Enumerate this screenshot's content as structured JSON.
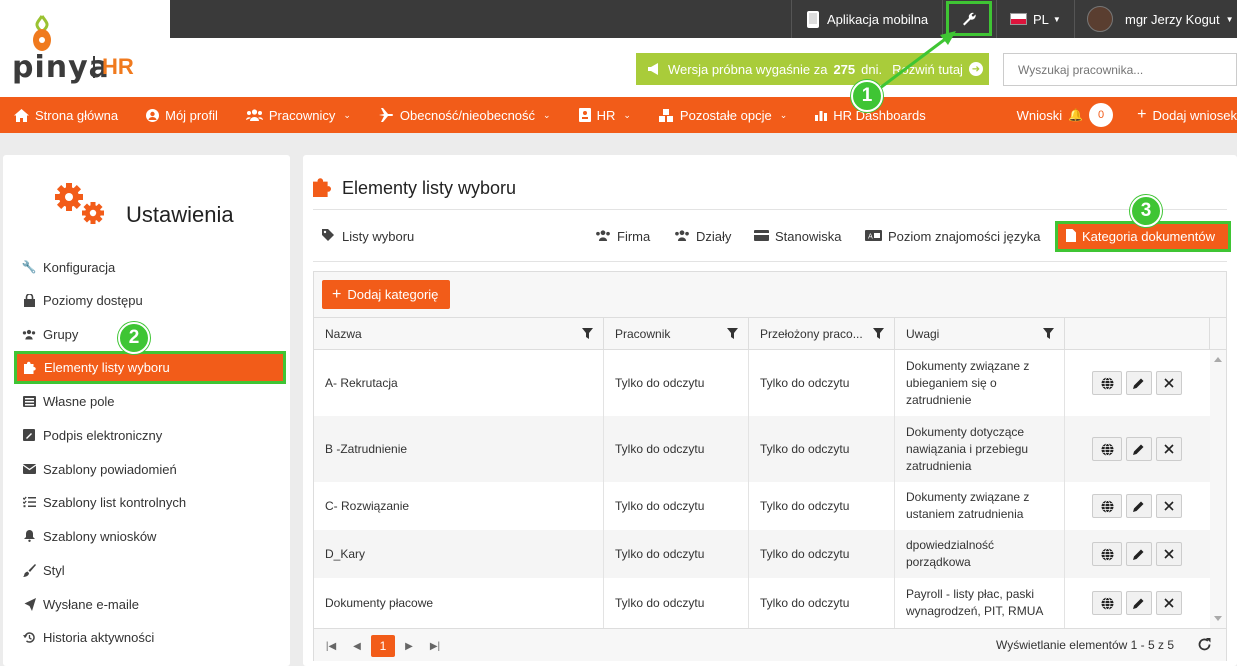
{
  "brand": {
    "logo_name": "pinya",
    "logo_suffix": "HR",
    "accent": "#f25c19",
    "highlight": "#3fc534"
  },
  "topbar": {
    "mobile_app": "Aplikacja mobilna",
    "language": "PL",
    "user": "mgr Jerzy Kogut"
  },
  "trial": {
    "text_before": "Wersja próbna wygaśnie za",
    "days": "275",
    "text_after": "dni.",
    "link": "Rozwiń tutaj"
  },
  "search": {
    "placeholder": "Wyszukaj pracownika..."
  },
  "nav": {
    "items": [
      {
        "label": "Strona główna",
        "icon": "home-icon"
      },
      {
        "label": "Mój profil",
        "icon": "user-icon"
      },
      {
        "label": "Pracownicy",
        "icon": "users-icon"
      },
      {
        "label": "Obecność/nieobecność",
        "icon": "plane-icon"
      },
      {
        "label": "HR",
        "icon": "id-card-icon"
      },
      {
        "label": "Pozostałe opcje",
        "icon": "cubes-icon"
      },
      {
        "label": "HR Dashboards",
        "icon": "chart-icon"
      }
    ],
    "requests": "Wnioski",
    "requests_count": "0",
    "add_request": "Dodaj wniosek"
  },
  "settings": {
    "title": "Ustawienia",
    "menu": [
      {
        "label": "Konfiguracja",
        "icon": "wrench-icon"
      },
      {
        "label": "Poziomy dostępu",
        "icon": "lock-icon"
      },
      {
        "label": "Grupy",
        "icon": "users-icon"
      },
      {
        "label": "Elementy listy wyboru",
        "icon": "puzzle-icon"
      },
      {
        "label": "Własne pole",
        "icon": "list-icon"
      },
      {
        "label": "Podpis elektroniczny",
        "icon": "signature-icon"
      },
      {
        "label": "Szablony powiadomień",
        "icon": "envelope-icon"
      },
      {
        "label": "Szablony list kontrolnych",
        "icon": "checklist-icon"
      },
      {
        "label": "Szablony wniosków",
        "icon": "bell-icon"
      },
      {
        "label": "Styl",
        "icon": "brush-icon"
      },
      {
        "label": "Wysłane e-maile",
        "icon": "send-icon"
      },
      {
        "label": "Historia aktywności",
        "icon": "history-icon"
      }
    ]
  },
  "main": {
    "title": "Elementy listy wyboru",
    "tabs": [
      {
        "label": "Listy wyboru",
        "icon": "tag-icon"
      },
      {
        "label": "Firma",
        "icon": "users-icon"
      },
      {
        "label": "Działy",
        "icon": "users-icon"
      },
      {
        "label": "Stanowiska",
        "icon": "card-icon"
      },
      {
        "label": "Poziom znajomości języka",
        "icon": "language-icon"
      },
      {
        "label": "Kategoria dokumentów",
        "icon": "file-icon"
      }
    ],
    "add_button": "Dodaj kategorię",
    "columns": [
      "Nazwa",
      "Pracownik",
      "Przełożony praco...",
      "Uwagi"
    ],
    "rows": [
      {
        "name": "A- Rekrutacja",
        "employee": "Tylko do odczytu",
        "manager": "Tylko do odczytu",
        "notes": [
          "Dokumenty związane z",
          "ubieganiem się o",
          "zatrudnienie"
        ]
      },
      {
        "name": "B -Zatrudnienie",
        "employee": "Tylko do odczytu",
        "manager": "Tylko do odczytu",
        "notes": [
          "Dokumenty dotyczące",
          "nawiązania i przebiegu",
          "zatrudnienia"
        ]
      },
      {
        "name": "C- Rozwiązanie",
        "employee": "Tylko do odczytu",
        "manager": "Tylko do odczytu",
        "notes": [
          "Dokumenty związane z",
          "ustaniem zatrudnienia"
        ]
      },
      {
        "name": "D_Kary",
        "employee": "Tylko do odczytu",
        "manager": "Tylko do odczytu",
        "notes": [
          "dpowiedzialność",
          "porządkowa"
        ]
      },
      {
        "name": "Dokumenty płacowe",
        "employee": "Tylko do odczytu",
        "manager": "Tylko do odczytu",
        "notes": [
          "Payroll - listy płac, paski",
          "wynagrodzeń, PIT, RMUA"
        ]
      }
    ],
    "pager": {
      "current": "1",
      "info": "Wyświetlanie elementów 1 - 5 z 5"
    }
  },
  "callouts": [
    "1",
    "2",
    "3"
  ]
}
